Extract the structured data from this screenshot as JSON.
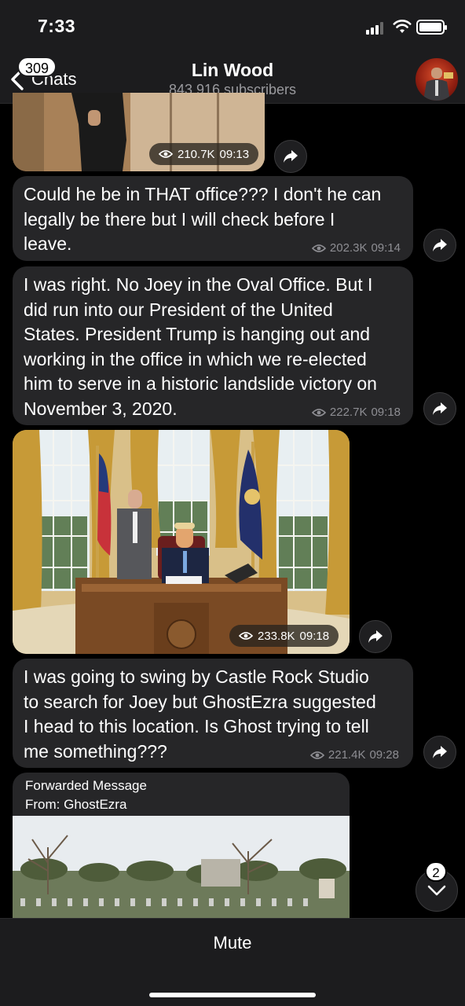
{
  "status_bar": {
    "time": "7:33"
  },
  "header": {
    "back_badge": "309",
    "back_label": "Chats",
    "title": "Lin Wood",
    "subtitle": "843,916 subscribers"
  },
  "messages": [
    {
      "type": "photo",
      "views": "210.7K",
      "time": "09:13"
    },
    {
      "type": "text",
      "text_lines": [
        "Could he be in THAT office??? I don't he can",
        "legally be there but I will check before I",
        "leave."
      ],
      "views": "202.3K",
      "time": "09:14"
    },
    {
      "type": "text",
      "text_lines": [
        "I was right. No Joey in the Oval Office. But I",
        "did run into our President of the United",
        "States. President Trump is hanging out and",
        "working in the office in which we re-elected",
        "him to serve in a historic landslide victory on",
        "November 3, 2020."
      ],
      "views": "222.7K",
      "time": "09:18"
    },
    {
      "type": "photo",
      "views": "233.8K",
      "time": "09:18"
    },
    {
      "type": "text",
      "text_lines": [
        "I was going to swing by Castle Rock Studio",
        "to search for Joey but GhostEzra suggested",
        "I head to this location. Is Ghost trying to tell",
        "me something???"
      ],
      "views": "221.4K",
      "time": "09:28"
    },
    {
      "type": "forwarded",
      "forwarded_label": "Forwarded Message",
      "from_label": "From: GhostEzra"
    }
  ],
  "scroll_down_badge": "2",
  "bottom": {
    "mute_label": "Mute"
  },
  "icons": {
    "views": "eye-icon",
    "forward": "share-arrow-icon",
    "back": "chevron-left-icon",
    "scroll": "chevron-down-icon"
  },
  "colors": {
    "background": "#000000",
    "bubble": "#262628",
    "meta_text": "#8e8e93"
  }
}
